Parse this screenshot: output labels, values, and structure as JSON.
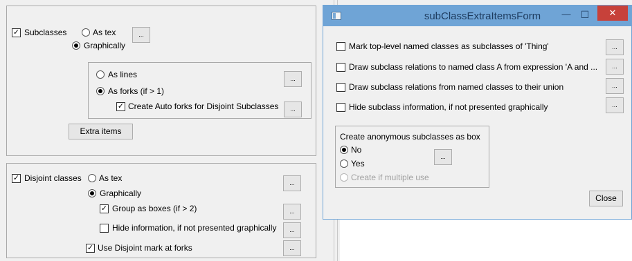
{
  "left_panel": {
    "subclasses_group": {
      "subclasses_label": "Subclasses",
      "as_text_label": "As tex",
      "graphically_label": "Graphically",
      "dots_label": "...",
      "subgroup": {
        "as_lines_label": "As lines",
        "as_forks_label": "As forks (if > 1)",
        "auto_forks_label": "Create Auto forks for Disjoint Subclasses"
      },
      "extra_items_label": "Extra items"
    },
    "disjoint_group": {
      "disjoint_label": "Disjoint classes",
      "as_text_label": "As tex",
      "graphically_label": "Graphically",
      "group_boxes_label": "Group as boxes (if > 2)",
      "hide_info_label": "Hide information, if not presented graphically",
      "use_mark_label": "Use Disjoint mark at forks"
    }
  },
  "dialog": {
    "title": "subClassExtraItemsForm",
    "minimize_glyph": "—",
    "maximize_glyph": "☐",
    "close_glyph": "✕",
    "options": [
      {
        "label": "Mark top-level named classes as subclasses of 'Thing'",
        "checked": false
      },
      {
        "label": "Draw subclass relations to named class A from expression 'A and ...",
        "checked": false
      },
      {
        "label": "Draw subclass relations from named classes to their union",
        "checked": false
      },
      {
        "label": "Hide subclass information, if not presented graphically",
        "checked": false
      }
    ],
    "anon_group": {
      "heading": "Create anonymous subclasses as box",
      "no_label": "No",
      "yes_label": "Yes",
      "multi_label": "Create if multiple use"
    },
    "close_button_label": "Close"
  },
  "colors": {
    "titlebar": "#6fa4d6",
    "close_button": "#c7413a",
    "dialog_border": "#6fa4d6"
  }
}
